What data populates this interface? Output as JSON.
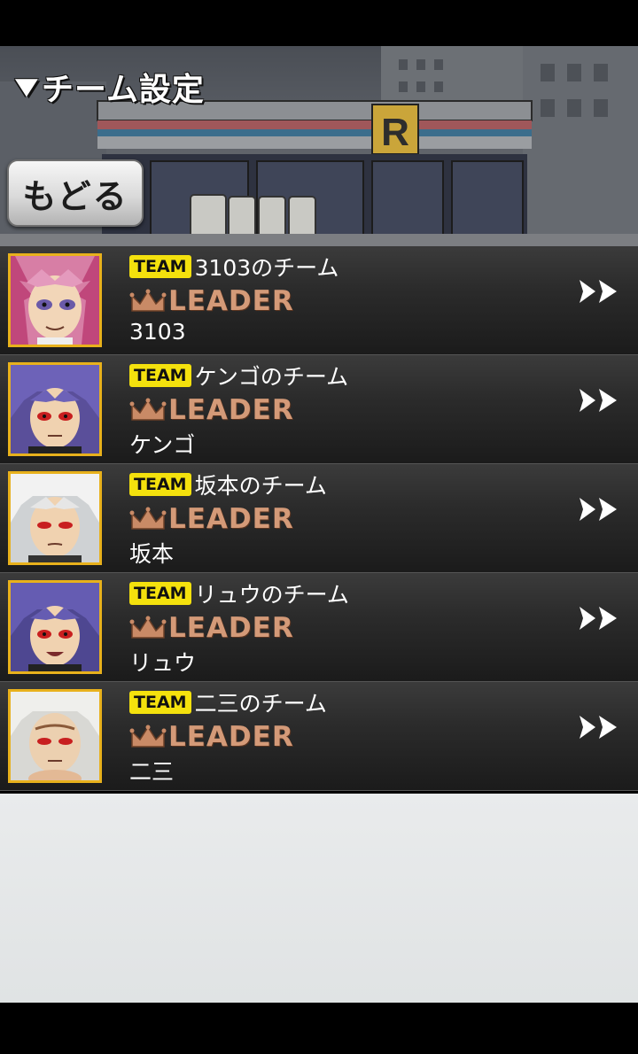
{
  "screen": {
    "title": "チーム設定",
    "back_label": "もどる"
  },
  "labels": {
    "team_badge": "TEAM",
    "leader": "LEADER"
  },
  "teams": [
    {
      "name": "3103のチーム",
      "leader": "3103"
    },
    {
      "name": "ケンゴのチーム",
      "leader": "ケンゴ"
    },
    {
      "name": "坂本のチーム",
      "leader": "坂本"
    },
    {
      "name": "リュウのチーム",
      "leader": "リュウ"
    },
    {
      "name": "二三のチーム",
      "leader": "二三"
    }
  ],
  "colors": {
    "accent_yellow": "#f4e10d",
    "avatar_border": "#e8b11c",
    "leader_bronze": "#d49a78"
  },
  "icons": [
    "chevron-down-icon",
    "crown-icon",
    "double-chevron-right-icon"
  ]
}
